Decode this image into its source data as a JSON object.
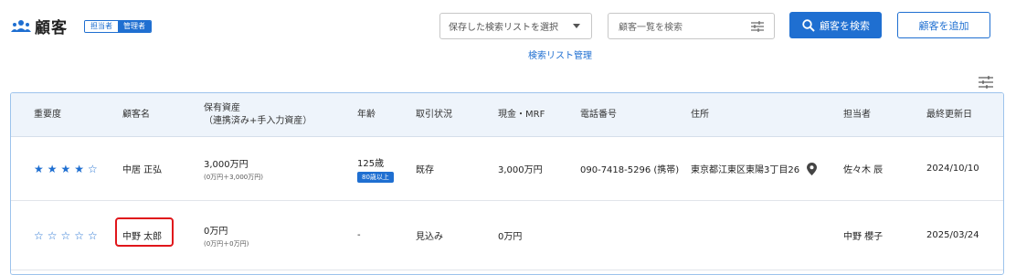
{
  "header": {
    "title": "顧客",
    "roles": [
      "担当者",
      "管理者"
    ],
    "saved_search_placeholder": "保存した検索リストを選択",
    "search_list_manage": "検索リスト管理",
    "search_placeholder": "顧客一覧を検索",
    "search_button": "顧客を検索",
    "add_button": "顧客を追加"
  },
  "colors": {
    "accent": "#1f6fd1",
    "highlight": "#e0161b"
  },
  "icons": [
    "people-icon",
    "caret-down-icon",
    "filter-icon",
    "search-icon",
    "settings-sliders-icon",
    "location-pin-icon"
  ],
  "table": {
    "columns": [
      "重要度",
      "顧客名",
      "保有資産",
      "（連携済み+手入力資産）",
      "年齢",
      "取引状況",
      "現金・MRF",
      "電話番号",
      "住所",
      "担当者",
      "最終更新日"
    ],
    "rows": [
      {
        "stars": "★★★★☆",
        "rating": 4,
        "name": "中居 正弘",
        "asset_main": "3,000万円",
        "asset_sub": "(0万円＋3,000万円)",
        "age": "125歳",
        "age_badge": "80歳以上",
        "status": "既存",
        "cash": "3,000万円",
        "phone": "090-7418-5296 (携帯)",
        "address": "東京都江東区東陽3丁目26",
        "staff": "佐々木 辰",
        "updated": "2024/10/10"
      },
      {
        "stars": "☆☆☆☆☆",
        "rating": 0,
        "name": "中野 太郎",
        "asset_main": "0万円",
        "asset_sub": "(0万円＋0万円)",
        "age": "-",
        "status": "見込み",
        "cash": "0万円",
        "phone": "",
        "address": "",
        "staff": "中野 櫻子",
        "updated": "2025/03/24"
      }
    ]
  }
}
